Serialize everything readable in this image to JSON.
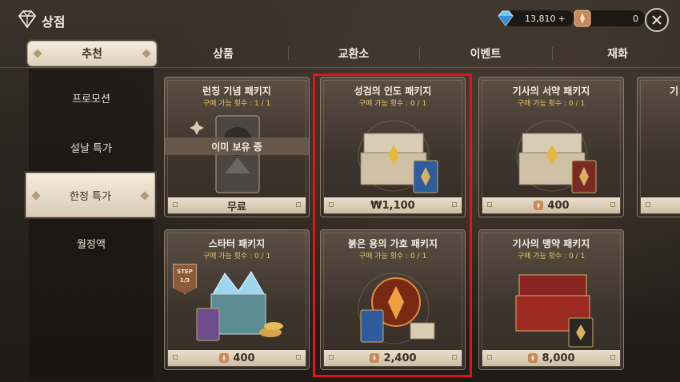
{
  "header": {
    "title": "상점",
    "gems": "13,810",
    "gems_add": "+",
    "gold": "0",
    "close_icon": "close-icon"
  },
  "tabs": [
    {
      "label": "추천",
      "active": true
    },
    {
      "label": "상품"
    },
    {
      "label": "교환소"
    },
    {
      "label": "이벤트"
    },
    {
      "label": "재화"
    }
  ],
  "sidebar": {
    "items": [
      {
        "label": "프로모션"
      },
      {
        "label": "설날 특가"
      },
      {
        "label": "한정 특가",
        "active": true
      },
      {
        "label": "월정액"
      }
    ]
  },
  "cards": [
    {
      "title": "런칭 기념 패키지",
      "limit": "구매 가능 횟수 : 1 / 1",
      "price": "무료",
      "owned": "이미 보유 중",
      "price_icon": ""
    },
    {
      "title": "성검의 인도 패키지",
      "limit": "구매 가능 횟수 : 0 / 1",
      "price": "₩1,100",
      "price_icon": ""
    },
    {
      "title": "기사의 서약 패키지",
      "limit": "구매 가능 횟수 : 0 / 1",
      "price": "400",
      "price_icon": "gold-coin-icon"
    },
    {
      "title": "기",
      "limit": "",
      "price": "",
      "price_icon": ""
    },
    {
      "title": "스타터 패키지",
      "limit": "구매 가능 횟수 : 0 / 1",
      "price": "400",
      "price_icon": "gold-coin-icon",
      "step": "STEP",
      "step_value": "1/3"
    },
    {
      "title": "붉은 용의 가호 패키지",
      "limit": "구매 가능 횟수 : 0 / 1",
      "price": "2,400",
      "price_icon": "gold-coin-icon"
    },
    {
      "title": "기사의 맹약 패키지",
      "limit": "구매 가능 횟수 : 0 / 1",
      "price": "8,000",
      "price_icon": "gold-coin-icon"
    }
  ],
  "colors": {
    "highlight": "#e0141c",
    "gold_text": "#e7c56a",
    "active_tab": "#f4ecdd"
  }
}
